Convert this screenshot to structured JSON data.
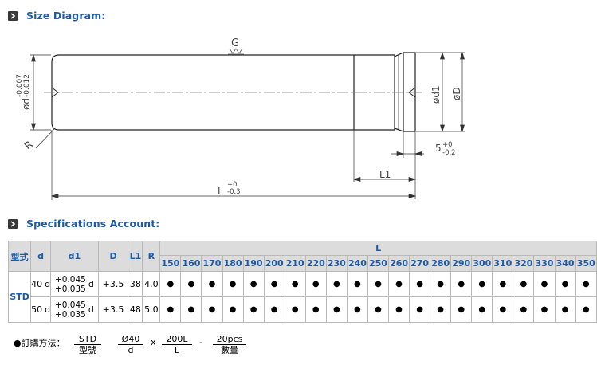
{
  "sections": {
    "size_diagram_title": "Size Diagram:",
    "specs_title": "Specifications Account:"
  },
  "diagram": {
    "label_g": "G",
    "label_d": "ød",
    "label_d_tol_upper": "-0.007",
    "label_d_tol_lower": "-0.012",
    "label_r": "R",
    "label_d1": "ød1",
    "label_big_d": "øD",
    "label_five": "5",
    "label_five_tol_upper": "+0",
    "label_five_tol_lower": "-0.2",
    "label_l1": "L1",
    "label_l": "L",
    "label_l_tol_upper": "+0",
    "label_l_tol_lower": "-0.3"
  },
  "table": {
    "headers": {
      "type": "型式",
      "d": "d",
      "d1": "d1",
      "D": "D",
      "L1": "L1",
      "R": "R",
      "L": "L"
    },
    "lengths": [
      "150",
      "160",
      "170",
      "180",
      "190",
      "200",
      "210",
      "220",
      "230",
      "240",
      "250",
      "260",
      "270",
      "280",
      "290",
      "300",
      "310",
      "320",
      "330",
      "340",
      "350"
    ],
    "type_value": "STD",
    "rows": [
      {
        "d": "40",
        "d_suffix": "d",
        "d1_upper": "+0.045",
        "d1_lower": "+0.035",
        "d1_suffix": "d",
        "D": "+3.5",
        "L1": "38",
        "R": "4.0",
        "marks": [
          "●",
          "●",
          "●",
          "●",
          "●",
          "●",
          "●",
          "●",
          "●",
          "●",
          "●",
          "●",
          "●",
          "●",
          "●",
          "●",
          "●",
          "●",
          "●",
          "●",
          "●"
        ]
      },
      {
        "d": "50",
        "d_suffix": "d",
        "d1_upper": "+0.045",
        "d1_lower": "+0.035",
        "d1_suffix": "d",
        "D": "+3.5",
        "L1": "48",
        "R": "5.0",
        "marks": [
          "●",
          "●",
          "●",
          "●",
          "●",
          "●",
          "●",
          "●",
          "●",
          "●",
          "●",
          "●",
          "●",
          "●",
          "●",
          "●",
          "●",
          "●",
          "●",
          "●",
          "●"
        ]
      }
    ]
  },
  "order": {
    "label": "●訂購方法：",
    "parts": [
      {
        "num": "STD",
        "den": "型號"
      },
      {
        "num": "Ø40",
        "den": "d"
      },
      {
        "num": "200L",
        "den": "L"
      },
      {
        "num": "20pcs",
        "den": "數量"
      }
    ],
    "sep_x": "x",
    "sep_dash": "-"
  }
}
